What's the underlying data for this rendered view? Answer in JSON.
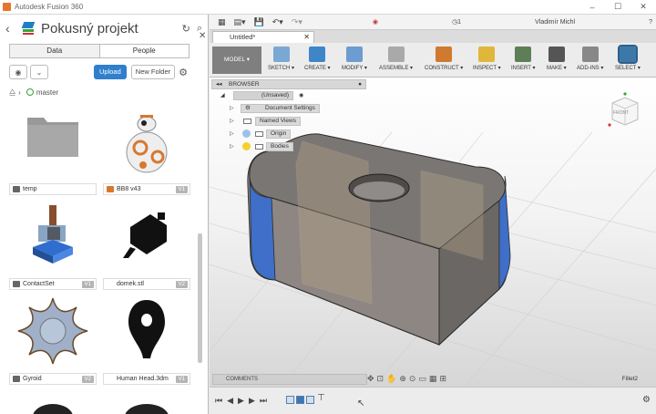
{
  "window": {
    "title": "Autodesk Fusion 360",
    "controls": [
      "–",
      "☐",
      "✕"
    ]
  },
  "data_panel": {
    "project_title": "Pokusný projekt",
    "tabs": {
      "data": "Data",
      "people": "People"
    },
    "upload_label": "Upload",
    "new_folder_label": "New Folder",
    "branch": "master",
    "files": [
      {
        "name": "temp",
        "version": "",
        "icon": "folder-icon"
      },
      {
        "name": "BB8 v43",
        "version": "V1",
        "icon": "design-icon"
      },
      {
        "name": "ContactSet",
        "version": "V1",
        "icon": "design-icon"
      },
      {
        "name": "domek.stl",
        "version": "V2",
        "icon": "mesh-icon"
      },
      {
        "name": "Gyroid",
        "version": "V2",
        "icon": "design-icon"
      },
      {
        "name": "Human Head.3dm",
        "version": "V1",
        "icon": "mesh-icon"
      }
    ]
  },
  "toolbar": {
    "notifications": "1",
    "user": "Vladimír Michl",
    "help": "?"
  },
  "document_tab": {
    "label": "Untitled*"
  },
  "ribbon": {
    "workspace": "MODEL ▾",
    "groups": [
      "SKETCH ▾",
      "CREATE ▾",
      "MODIFY ▾",
      "ASSEMBLE ▾",
      "CONSTRUCT ▾",
      "INSPECT ▾",
      "INSERT ▾",
      "MAKE ▾",
      "ADD-INS ▾",
      "SELECT ▾"
    ]
  },
  "browser": {
    "title": "BROWSER",
    "root": "(Unsaved)",
    "items": [
      "Document Settings",
      "Named Views",
      "Origin",
      "Bodies"
    ]
  },
  "viewcube": {
    "label": "FRONT"
  },
  "bottom": {
    "comments": "COMMENTS",
    "active_feature": "Fillet2"
  }
}
